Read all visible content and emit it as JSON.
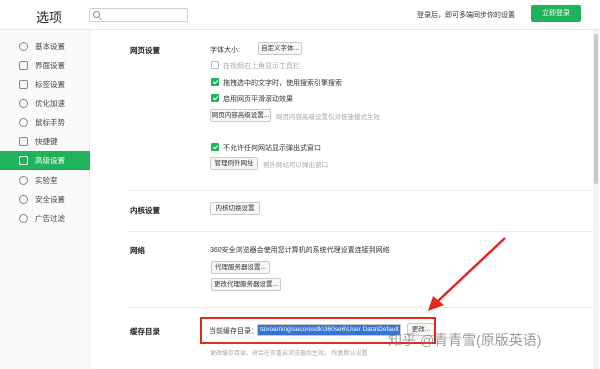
{
  "header": {
    "title": "选项",
    "search_placeholder": "",
    "login_hint": "登录后，即可多端同步你的设置",
    "login_button": "立即登录"
  },
  "sidebar": {
    "items": [
      {
        "label": "基本设置",
        "icon": "settings-icon"
      },
      {
        "label": "界面设置",
        "icon": "layout-icon"
      },
      {
        "label": "标签设置",
        "icon": "tag-icon"
      },
      {
        "label": "优化加速",
        "icon": "rocket-icon"
      },
      {
        "label": "鼠标手势",
        "icon": "mouse-icon"
      },
      {
        "label": "快捷键",
        "icon": "keyboard-icon"
      },
      {
        "label": "高级设置",
        "icon": "advanced-icon",
        "active": true
      },
      {
        "label": "实验室",
        "icon": "lab-icon"
      },
      {
        "label": "安全设置",
        "icon": "shield-icon"
      },
      {
        "label": "广告过滤",
        "icon": "filter-icon"
      }
    ]
  },
  "web": {
    "title": "网页设置",
    "font_size_label": "字体大小:",
    "custom_font_button": "自定义字体...",
    "opt_video_toolbar": "在视频右上角显示工具栏",
    "opt_drag_search": "拖拽选中的文字时，使用搜索引擎搜索",
    "opt_smooth_scroll": "启用网页平滑滚动效果",
    "content_advanced_button": "网页内容高级设置...",
    "content_advanced_hint": "网页内容高级设置仅对极速模式生效",
    "opt_block_popups": "不允许任何网站显示弹出式窗口",
    "manage_exceptions_button": "管理例外网址",
    "exceptions_hint": "例外网站可以弹出窗口"
  },
  "kernel": {
    "title": "内核设置",
    "switch_button": "内核切换设置"
  },
  "network": {
    "title": "网络",
    "desc": "360安全浏览器会使用您计算机的系统代理设置连接到网络",
    "proxy_button": "代理服务器设置...",
    "change_proxy_button": "更改代理服务器设置..."
  },
  "cache": {
    "title": "缓存目录",
    "current_label": "当前缓存目录：",
    "path": "ta\\roaming\\secoresdk\\360se6\\User Data\\Default",
    "change_button": "更改...",
    "footnote": "更改缓存目录，将会在你重启浏览器后生效。  恢复默认设置"
  },
  "watermark": "知乎 @青青雪(原版英语)",
  "colors": {
    "accent": "#21b35b",
    "highlight_box": "#e02a1f",
    "selection": "#3573d9"
  }
}
